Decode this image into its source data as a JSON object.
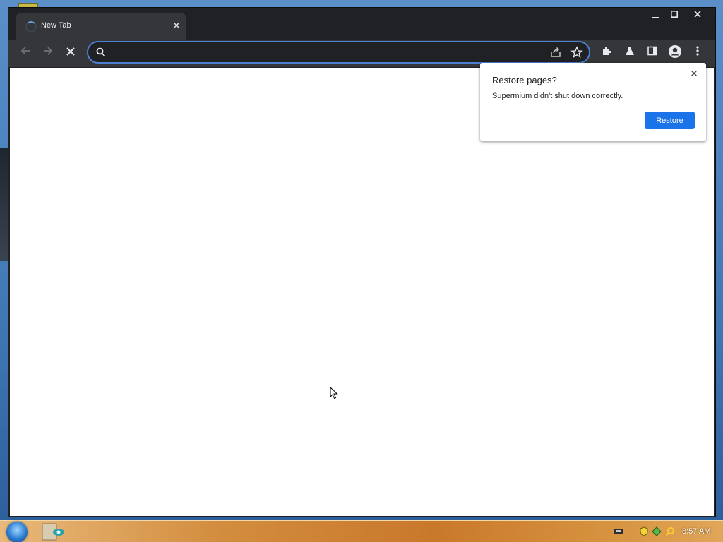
{
  "browser": {
    "tab": {
      "title": "New Tab"
    },
    "omnibox": {
      "value": "",
      "placeholder": ""
    }
  },
  "popup": {
    "title": "Restore pages?",
    "message": "Supermium didn't shut down correctly.",
    "restore_label": "Restore"
  },
  "taskbar": {
    "clock": "8:57 AM"
  },
  "colors": {
    "accent": "#1a73e8",
    "omnibox_focus": "#4b7fd1",
    "frame": "#202124",
    "toolbar": "#35363a"
  },
  "icons": [
    "tab-loading-spinner-icon",
    "close-icon",
    "minimize-icon",
    "maximize-icon",
    "back-icon",
    "forward-icon",
    "stop-loading-icon",
    "search-icon",
    "share-icon",
    "bookmark-star-icon",
    "extensions-puzzle-icon",
    "labs-flask-icon",
    "side-panel-icon",
    "profile-avatar-icon",
    "menu-kebab-icon",
    "start-orb-icon"
  ]
}
